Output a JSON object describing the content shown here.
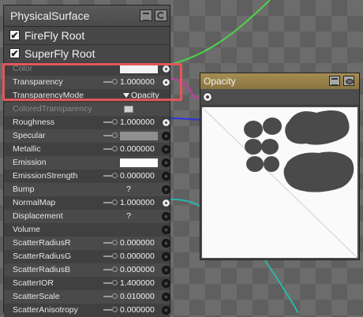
{
  "surface_node": {
    "title": "PhysicalSurface",
    "roots": [
      {
        "label": "FireFly Root",
        "checked": true,
        "check_glyph": "✔"
      },
      {
        "label": "SuperFly Root",
        "checked": true,
        "check_glyph": "✔"
      }
    ],
    "properties": [
      {
        "label": "Color",
        "kind": "color",
        "color": "#f2f2f2",
        "socket": "connected",
        "dim": true
      },
      {
        "label": "Transparency",
        "kind": "number",
        "value": "1.000000",
        "keyed": true,
        "socket": "connected"
      },
      {
        "label": "TransparencyMode",
        "kind": "menu",
        "value": "Opacity",
        "socket": "none"
      },
      {
        "label": "ColoredTransparency",
        "kind": "slider",
        "socket": "none",
        "dim": true
      },
      {
        "label": "Roughness",
        "kind": "number",
        "value": "1.000000",
        "keyed": true,
        "socket": "connected"
      },
      {
        "label": "Specular",
        "kind": "color",
        "color": "#8f8f8f",
        "keyed": true,
        "socket": "dot"
      },
      {
        "label": "Metallic",
        "kind": "number",
        "value": "0.000000",
        "keyed": true,
        "socket": "dot"
      },
      {
        "label": "Emission",
        "kind": "color",
        "color": "#ffffff",
        "socket": "dot"
      },
      {
        "label": "EmissionStrength",
        "kind": "number",
        "value": "0.000000",
        "keyed": true,
        "socket": "dot"
      },
      {
        "label": "Bump",
        "kind": "text",
        "value": "?",
        "socket": "dot"
      },
      {
        "label": "NormalMap",
        "kind": "number",
        "value": "1.000000",
        "keyed": true,
        "socket": "connected"
      },
      {
        "label": "Displacement",
        "kind": "text",
        "value": "?",
        "socket": "dot"
      },
      {
        "label": "Volume",
        "kind": "empty",
        "socket": "dot"
      },
      {
        "label": "ScatterRadiusR",
        "kind": "number",
        "value": "0.000000",
        "keyed": true,
        "socket": "dot"
      },
      {
        "label": "ScatterRadiusG",
        "kind": "number",
        "value": "0.000000",
        "keyed": true,
        "socket": "dot"
      },
      {
        "label": "ScatterRadiusB",
        "kind": "number",
        "value": "0.000000",
        "keyed": true,
        "socket": "dot"
      },
      {
        "label": "ScatterIOR",
        "kind": "number",
        "value": "1.400000",
        "keyed": true,
        "socket": "dot"
      },
      {
        "label": "ScatterScale",
        "kind": "number",
        "value": "0.010000",
        "keyed": true,
        "socket": "dot"
      },
      {
        "label": "ScatterAnisotropy",
        "kind": "number",
        "value": "0.000000",
        "keyed": true,
        "socket": "dot"
      }
    ]
  },
  "opacity_node": {
    "title": "Opacity",
    "header_color": "#9b8449",
    "preview_shape_color": "#4a4a4a"
  },
  "wire_colors": {
    "green": "#4fd14a",
    "magenta": "#c43ea6",
    "blue": "#3030d8",
    "teal": "#2ab6a8"
  },
  "highlight_color": "#e4555b"
}
